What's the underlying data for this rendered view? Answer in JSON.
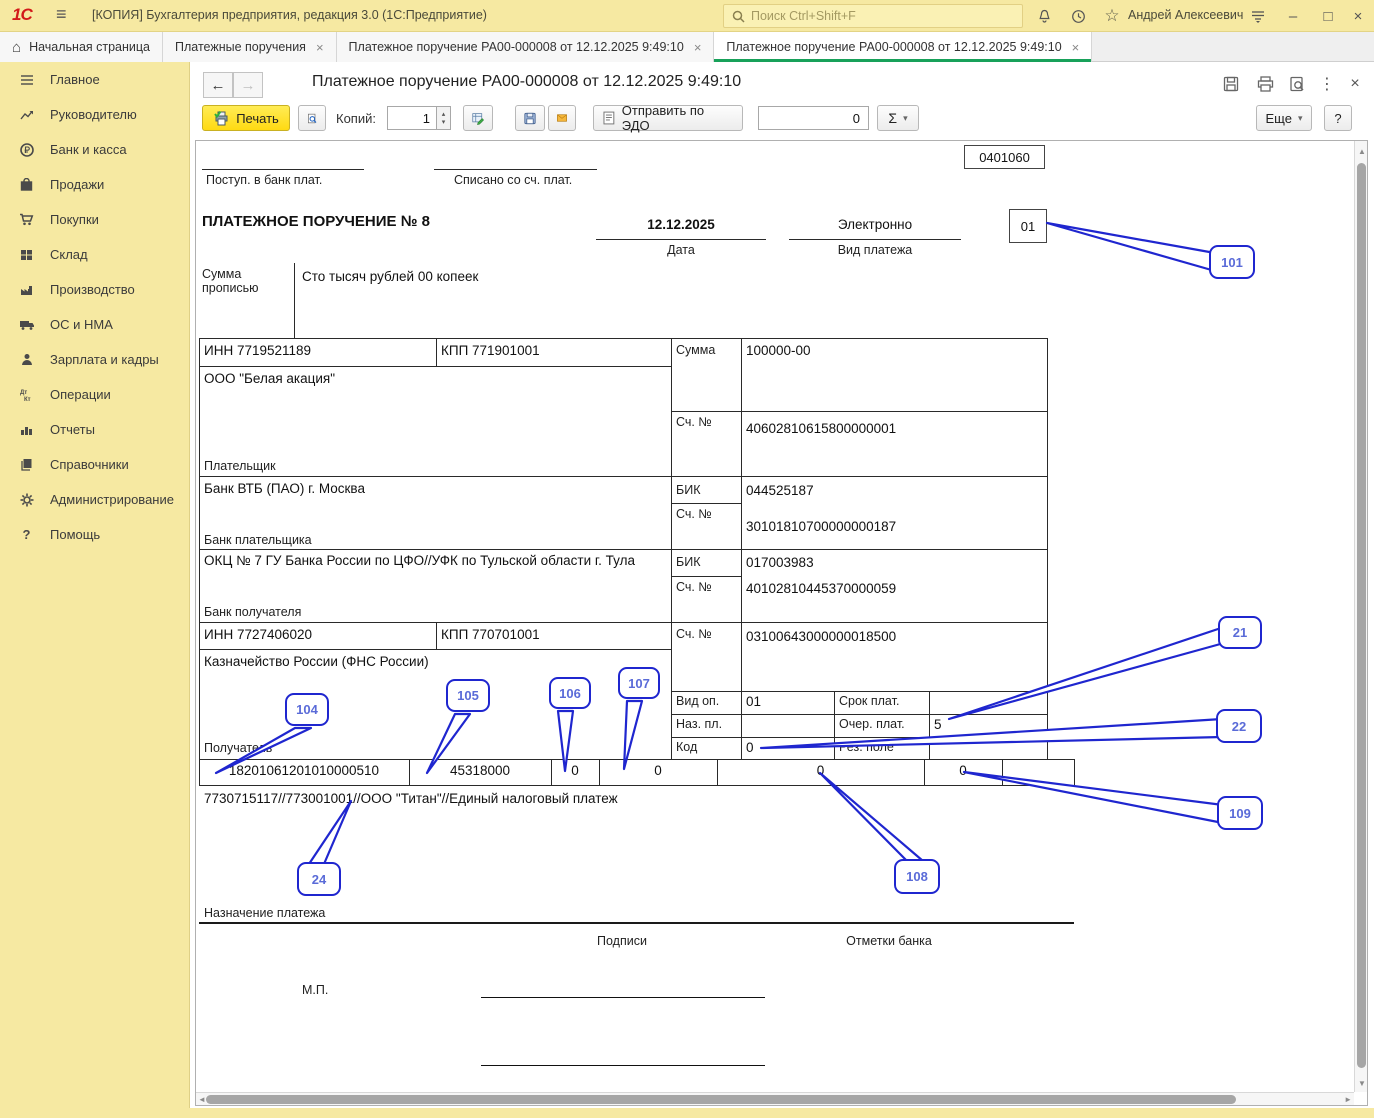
{
  "colors": {
    "brand_yellow": "#f6e9a2",
    "print_button_yellow": "#ffda12",
    "active_tab_green": "#18a15a",
    "callout_blue": "#1f26cf",
    "logo_red": "#d21a1a"
  },
  "glyphs": {
    "burger": "≡",
    "home": "⌂",
    "star": "☆",
    "minimize": "–",
    "maximize": "□",
    "close": "×",
    "tab_close": "×",
    "back": "←",
    "forward": "→",
    "dots": "⋮",
    "caret_up": "▴",
    "caret_down": "▾",
    "sigma": "Σ",
    "question": "?",
    "up_arrow": "▲",
    "down_arrow": "▼",
    "left_arrow": "◄",
    "right_arrow": "►"
  },
  "titlebar": {
    "logo": "1С",
    "title": "[КОПИЯ] Бухгалтерия предприятия, редакция 3.0  (1С:Предприятие)",
    "search_placeholder": "Поиск Ctrl+Shift+F",
    "user": "Андрей Алексеевич"
  },
  "tabs": [
    {
      "label": "Начальная страница"
    },
    {
      "label": "Платежные поручения"
    },
    {
      "label": "Платежное поручение РА00-000008 от 12.12.2025 9:49:10"
    },
    {
      "label": "Платежное поручение РА00-000008 от 12.12.2025 9:49:10"
    }
  ],
  "sidebar": {
    "items": [
      {
        "label": "Главное"
      },
      {
        "label": "Руководителю"
      },
      {
        "label": "Банк и касса"
      },
      {
        "label": "Продажи"
      },
      {
        "label": "Покупки"
      },
      {
        "label": "Склад"
      },
      {
        "label": "Производство"
      },
      {
        "label": "ОС и НМА"
      },
      {
        "label": "Зарплата и кадры"
      },
      {
        "label": "Операции"
      },
      {
        "label": "Отчеты"
      },
      {
        "label": "Справочники"
      },
      {
        "label": "Администрирование"
      },
      {
        "label": "Помощь"
      }
    ]
  },
  "doc": {
    "title": "Платежное поручение РА00-000008 от 12.12.2025 9:49:10",
    "toolbar": {
      "print": "Печать",
      "copies_label": "Копий:",
      "copies_value": "1",
      "edo": "Отправить по ЭДО",
      "sum_value": "0",
      "more": "Еще"
    },
    "form": {
      "header": {
        "postup": "Поступ. в банк плат.",
        "spisano": "Списано со сч. плат.",
        "form_code": "0401060",
        "title": "ПЛАТЕЖНОЕ ПОРУЧЕНИЕ № 8",
        "date_value": "12.12.2025",
        "date_label": "Дата",
        "kind_value": "Электронно",
        "kind_label": "Вид платежа",
        "status_box": "01"
      },
      "amount_words_label": "Сумма прописью",
      "amount_words": "Сто тысяч рублей 00 копеек",
      "payer": {
        "inn": "ИНН 7719521189",
        "kpp": "КПП 771901001",
        "sum_label": "Сумма",
        "sum": "100000-00",
        "name": "ООО \"Белая акация\"",
        "acc_label": "Сч. №",
        "acc": "40602810615800000001",
        "label": "Плательщик"
      },
      "payer_bank": {
        "name": "Банк ВТБ (ПАО) г. Москва",
        "bik_label": "БИК",
        "bik": "044525187",
        "acc_label": "Сч. №",
        "acc": "30101810700000000187",
        "label": "Банк плательщика"
      },
      "receiver_bank": {
        "name": "ОКЦ № 7 ГУ Банка России по ЦФО//УФК по Тульской области г. Тула",
        "bik_label": "БИК",
        "bik": "017003983",
        "acc_label": "Сч. №",
        "acc": "40102810445370000059",
        "label": "Банк получателя"
      },
      "receiver": {
        "inn": "ИНН 7727406020",
        "kpp": "КПП 770701001",
        "acc_label": "Сч. №",
        "acc": "03100643000000018500",
        "name": "Казначейство России (ФНС России)",
        "label": "Получатель",
        "vid_op_label": "Вид оп.",
        "vid_op": "01",
        "srok_label": "Срок плат.",
        "naz_pl_label": "Наз. пл.",
        "ocher_label": "Очер. плат.",
        "ocher": "5",
        "kod_label": "Код",
        "kod": "0",
        "rez_label": "Рез. поле"
      },
      "tax_row": [
        "18201061201010000510",
        "45318000",
        "0",
        "0",
        "0",
        "0"
      ],
      "purpose": "7730715117//773001001//ООО \"Титан\"//Единый налоговый платеж",
      "purpose_label": "Назначение платежа",
      "signatures_label": "Подписи",
      "bank_marks_label": "Отметки банка",
      "mp": "М.П."
    },
    "callouts": [
      {
        "label": "101"
      },
      {
        "label": "21"
      },
      {
        "label": "22"
      },
      {
        "label": "109"
      },
      {
        "label": "104"
      },
      {
        "label": "105"
      },
      {
        "label": "106"
      },
      {
        "label": "107"
      },
      {
        "label": "24"
      },
      {
        "label": "108"
      }
    ]
  }
}
